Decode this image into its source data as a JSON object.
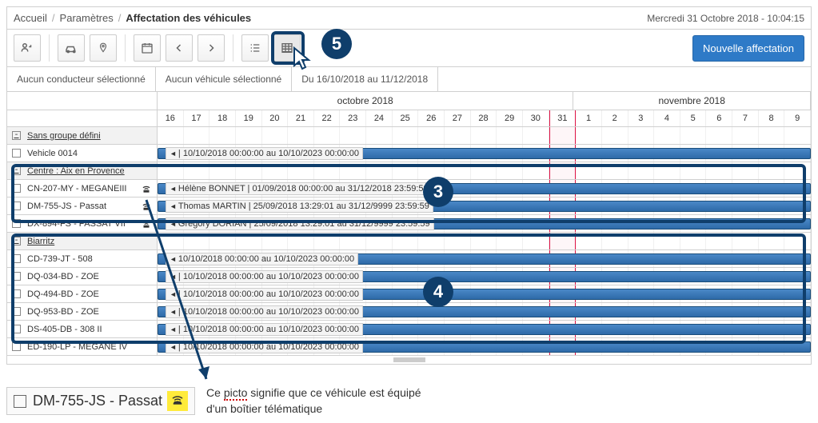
{
  "breadcrumb": {
    "home": "Accueil",
    "params": "Paramètres",
    "current": "Affectation des véhicules"
  },
  "datetime": "Mercredi 31 Octobre 2018 - 10:04:15",
  "buttons": {
    "new": "Nouvelle affectation"
  },
  "filters": {
    "driver": "Aucun conducteur sélectionné",
    "vehicle": "Aucun véhicule sélectionné",
    "period": "Du 16/10/2018 au 11/12/2018"
  },
  "months": {
    "m1": "octobre 2018",
    "m2": "novembre 2018"
  },
  "days": [
    "16",
    "17",
    "18",
    "19",
    "20",
    "21",
    "22",
    "23",
    "24",
    "25",
    "26",
    "27",
    "28",
    "29",
    "30",
    "31",
    "1",
    "2",
    "3",
    "4",
    "5",
    "6",
    "7",
    "8",
    "9"
  ],
  "today_index": 15,
  "groups": [
    {
      "label": "Sans groupe défini",
      "rows": [
        {
          "label": "Vehicle 0014",
          "text": "| 10/10/2018 00:00:00 au 10/10/2023 00:00:00"
        }
      ]
    },
    {
      "label": "Centre : Aix en Provence",
      "rows": [
        {
          "label": "CN-207-MY - MEGANEIII",
          "tel": true,
          "text": "Hélène BONNET | 01/09/2018 00:00:00 au 31/12/2018 23:59:59"
        },
        {
          "label": "DM-755-JS - Passat",
          "tel": true,
          "text": "Thomas MARTIN | 25/09/2018 13:29:01 au 31/12/9999 23:59:59"
        },
        {
          "label": "DX-894-FS - PASSAT VII",
          "tel": true,
          "text": "Gregory DORIAN | 25/09/2018 13:29:01 au 31/12/9999 23:59:59"
        }
      ]
    },
    {
      "label": "Biarritz",
      "rows": [
        {
          "label": "CD-739-JT - 508",
          "text": "10/10/2018 00:00:00 au 10/10/2023 00:00:00"
        },
        {
          "label": "DQ-034-BD - ZOE",
          "text": "| 10/10/2018 00:00:00 au 10/10/2023 00:00:00"
        },
        {
          "label": "DQ-494-BD - ZOE",
          "text": "| 10/10/2018 00:00:00 au 10/10/2023 00:00:00"
        },
        {
          "label": "DQ-953-BD - ZOE",
          "text": "| 10/10/2018 00:00:00 au 10/10/2023 00:00:00"
        },
        {
          "label": "DS-405-DB - 308 II",
          "text": "| 10/10/2018 00:00:00 au 10/10/2023 00:00:00"
        },
        {
          "label": "ED-190-LP - MEGANE IV",
          "text": "| 10/10/2018 00:00:00 au 10/10/2023 00:00:00"
        }
      ]
    }
  ],
  "legend": {
    "item": "DM-755-JS - Passat",
    "desc1": "Ce picto signifie que ce véhicule est équipé",
    "desc2": "d'un boîtier télématique",
    "underline": "picto"
  },
  "bubbles": {
    "b3": "3",
    "b4": "4",
    "b5": "5"
  }
}
